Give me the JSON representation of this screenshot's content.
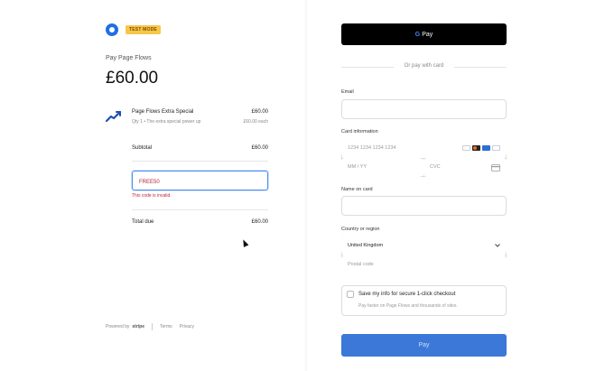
{
  "left": {
    "badge": "TEST MODE",
    "pay_to": "Pay Page Flows",
    "amount": "£60.00",
    "item": {
      "name": "Page Flows Extra Special",
      "sub": "Qty 1 • The extra special power up",
      "price": "£60.00",
      "sub_price": "£60.00 each"
    },
    "subtotal_label": "Subtotal",
    "subtotal_value": "£60.00",
    "promo_value": "FREE50",
    "promo_error": "This code is invalid.",
    "total_label": "Total due",
    "total_value": "£60.00",
    "footer": {
      "powered_by": "Powered by",
      "brand": "stripe",
      "terms": "Terms",
      "privacy": "Privacy"
    }
  },
  "right": {
    "gpay_label": "Pay",
    "or_text": "Or pay with card",
    "email_label": "Email",
    "card_label": "Card information",
    "card_number_placeholder": "1234 1234 1234 1234",
    "expiry_placeholder": "MM / YY",
    "cvc_placeholder": "CVC",
    "name_label": "Name on card",
    "country_label": "Country or region",
    "country_value": "United Kingdom",
    "postcode_placeholder": "Postal code",
    "save_title": "Save my info for secure 1-click checkout",
    "save_sub": "Pay faster on Page Flows and thousands of sites.",
    "pay_button": "Pay"
  },
  "colors": {
    "accent": "#3b78d8",
    "error": "#c0263f",
    "badge": "#f7c64a",
    "gpay": "#000000"
  },
  "icons": [
    "brand-logo-icon",
    "item-trend-icon",
    "cursor-icon",
    "card-brand-icons",
    "cvc-card-icon",
    "chevron-down-icon",
    "google-g-icon"
  ]
}
